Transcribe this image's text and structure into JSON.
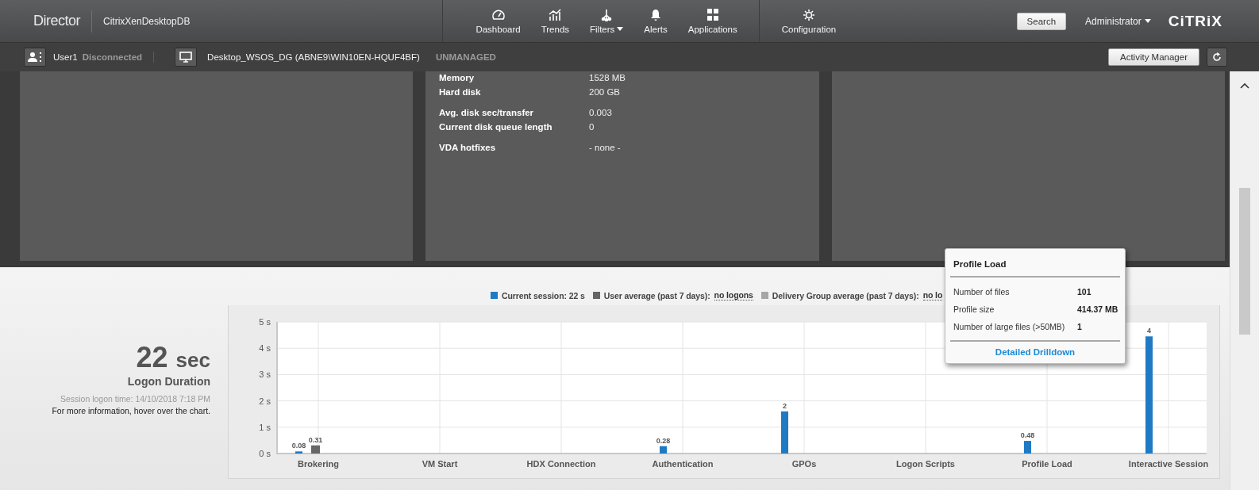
{
  "header": {
    "app_name": "Director",
    "site": "CitrixXenDesktopDB",
    "nav": [
      {
        "label": "Dashboard",
        "has_menu": false
      },
      {
        "label": "Trends",
        "has_menu": false
      },
      {
        "label": "Filters",
        "has_menu": true
      },
      {
        "label": "Alerts",
        "has_menu": false
      },
      {
        "label": "Applications",
        "has_menu": false
      },
      {
        "label": "Configuration",
        "has_menu": false
      }
    ],
    "search_button": "Search",
    "user_menu": "Administrator",
    "logo": "CiTRiX"
  },
  "context_bar": {
    "user": "User1",
    "user_status": "Disconnected",
    "machine": "Desktop_WSOS_DG (ABNE9\\WIN10EN-HQUF4BF)",
    "machine_status": "UNMANAGED",
    "activity_button": "Activity Manager"
  },
  "detail_groups": [
    [
      {
        "label": "Memory",
        "value": "1528 MB"
      },
      {
        "label": "Hard disk",
        "value": "200 GB"
      }
    ],
    [
      {
        "label": "Avg. disk sec/transfer",
        "value": "0.003"
      },
      {
        "label": "Current disk queue length",
        "value": "0"
      }
    ],
    [
      {
        "label": "VDA hotfixes",
        "value": "- none -"
      }
    ]
  ],
  "logon": {
    "duration": "22",
    "unit": "sec",
    "title": "Logon Duration",
    "logon_time": "Session logon time: 14/10/2018 7:18 PM",
    "hint": "For more information, hover over the chart."
  },
  "legend": [
    {
      "label": "Current session: 22 s",
      "color": "#1f7ac4"
    },
    {
      "label": "User average (past 7 days):",
      "link": "no logons",
      "color": "#666666"
    },
    {
      "label": "Delivery Group average (past 7 days):",
      "link": "no lo",
      "color": "#a6a6a6"
    }
  ],
  "chart_data": {
    "type": "bar",
    "categories": [
      "Brokering",
      "VM Start",
      "HDX Connection",
      "Authentication",
      "GPOs",
      "Logon Scripts",
      "Profile Load",
      "Interactive Session"
    ],
    "grid": true,
    "series": [
      {
        "color": "#1f7ac4",
        "values": [
          0.08,
          null,
          null,
          0.28,
          1.6,
          null,
          0.48,
          4.45
        ]
      },
      {
        "color": "#666666",
        "values": [
          0.31,
          null,
          null,
          null,
          null,
          null,
          null,
          null
        ]
      }
    ],
    "ylim": [
      0,
      5
    ],
    "yticks": [
      {
        "value": 0,
        "label": "0 s"
      },
      {
        "value": 1,
        "label": "1 s"
      },
      {
        "value": 2,
        "label": "2 s"
      },
      {
        "value": 3,
        "label": "3 s"
      },
      {
        "value": 4,
        "label": "4 s"
      },
      {
        "value": 5,
        "label": "5 s"
      }
    ],
    "value_labels": [
      [
        "0.08",
        null,
        null,
        "0.28",
        "2",
        null,
        "0.48",
        "4"
      ],
      [
        "0.31",
        null,
        null,
        null,
        null,
        null,
        null,
        null
      ]
    ]
  },
  "tooltip": {
    "title": "Profile Load",
    "rows": [
      {
        "label": "Number of files",
        "value": "101"
      },
      {
        "label": "Profile size",
        "value": "414.37 MB"
      },
      {
        "label": "Number of large files (>50MB)",
        "value": "1"
      }
    ],
    "link": "Detailed Drilldown"
  }
}
